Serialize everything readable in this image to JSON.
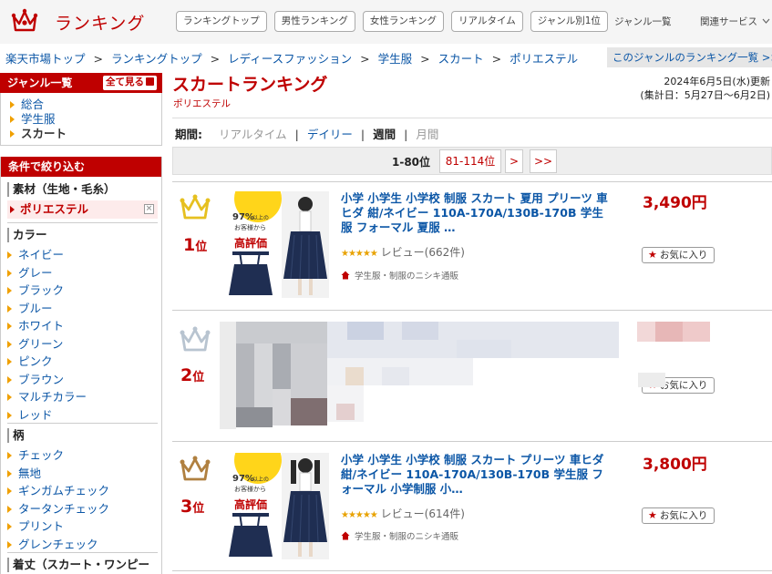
{
  "header": {
    "logo_text": "ランキング",
    "nav_buttons": [
      "ランキングトップ",
      "男性ランキング",
      "女性ランキング",
      "リアルタイム",
      "ジャンル別1位"
    ],
    "genre_list_label": "ジャンル一覧",
    "related_services_label": "関連サービス"
  },
  "breadcrumb": [
    "楽天市場トップ",
    "ランキングトップ",
    "レディースファッション",
    "学生服",
    "スカート",
    "ポリエステル"
  ],
  "genre_ranking_list_link": "このジャンルのランキング一覧 >>",
  "sidebar": {
    "genre_title": "ジャンル一覧",
    "see_all": "全て見る",
    "genre_items": [
      "総合",
      "学生服",
      "スカート"
    ],
    "filter_title": "条件で絞り込む",
    "material": {
      "title": "素材（生地・毛糸）",
      "selected": "ポリエステル",
      "remove": "×"
    },
    "color": {
      "title": "カラー",
      "items": [
        "ネイビー",
        "グレー",
        "ブラック",
        "ブルー",
        "ホワイト",
        "グリーン",
        "ピンク",
        "ブラウン",
        "マルチカラー",
        "レッド"
      ]
    },
    "pattern": {
      "title": "柄",
      "items": [
        "チェック",
        "無地",
        "ギンガムチェック",
        "タータンチェック",
        "プリント",
        "グレンチェック"
      ]
    },
    "length_title": "着丈（スカート・ワンピー"
  },
  "main": {
    "title": "スカートランキング",
    "subtitle": "ポリエステル",
    "updated": "2024年6月5日(水)更新",
    "period_range": "(集計日：5月27日〜6月2日)",
    "period_label": "期間:",
    "periods": [
      "リアルタイム",
      "デイリー",
      "週間",
      "月間"
    ],
    "selected_period": "週間",
    "pager": {
      "current": "1-80位",
      "next_range": "81-114位",
      "next": ">",
      "last": ">>"
    }
  },
  "items": [
    {
      "rank": "1",
      "rank_suffix": "位",
      "title": "小学 小学生 小学校 制服 スカート 夏用 プリーツ 車ヒダ 紺/ネイビー 110A-170A/130B-170B 学生服 フォーマル 夏服 …",
      "rating": 4.5,
      "stars": "★★★★★",
      "review": "レビュー(662件)",
      "shop": "学生服・制服のニシキ通販",
      "price": "3,490円",
      "fav": "お気に入り",
      "crown_color": "#e6c020",
      "badge_pct": "97%",
      "badge_text1": "以上の",
      "badge_text2": "お客様から",
      "badge_text3": "高評価"
    },
    {
      "rank": "2",
      "rank_suffix": "位",
      "fav": "お気に入り",
      "crown_color": "#b8c4d0"
    },
    {
      "rank": "3",
      "rank_suffix": "位",
      "title": "小学 小学生 小学校 制服 スカート プリーツ 車ヒダ 紺/ネイビー 110A-170A/130B-170B 学生服 フォーマル 小学制服 小…",
      "rating": 4.5,
      "stars": "★★★★★",
      "review": "レビュー(614件)",
      "shop": "学生服・制服のニシキ通販",
      "price": "3,800円",
      "fav": "お気に入り",
      "crown_color": "#b08040",
      "badge_pct": "97%",
      "badge_text1": "以上の",
      "badge_text2": "お客様から",
      "badge_text3": "高評価"
    }
  ]
}
